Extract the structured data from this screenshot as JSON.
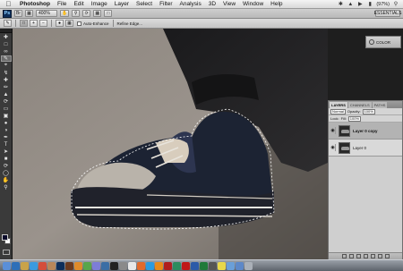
{
  "menubar": {
    "app_name": "Photoshop",
    "items": [
      "File",
      "Edit",
      "Image",
      "Layer",
      "Select",
      "Filter",
      "Analysis",
      "3D",
      "View",
      "Window",
      "Help"
    ],
    "battery_text": "(97%)",
    "icons": [
      "apple-icon",
      "bluetooth-icon",
      "wifi-icon",
      "volume-icon",
      "battery-icon",
      "search-icon"
    ]
  },
  "appbar": {
    "logo_text": "Ps",
    "zoom_value": "400%",
    "right_button": "ESSENTIALS"
  },
  "optbar": {
    "auto_enhance_label": "Auto-Enhance",
    "refine_edge_label": "Refine Edge..."
  },
  "collapsed_panel": {
    "label": "COLOR"
  },
  "layers_panel": {
    "tabs": [
      "LAYERS",
      "CHANNELS",
      "PATHS"
    ],
    "blend_mode": "Normal",
    "opacity_label": "Opacity:",
    "opacity_value": "100%",
    "fill_label": "Fill:",
    "fill_value": "100%",
    "lock_label": "Lock:",
    "layers": [
      {
        "name": "Layer 0 copy",
        "selected": true
      },
      {
        "name": "Layer 0",
        "selected": false
      }
    ]
  },
  "colors": {
    "foreground": "#0a0a2a",
    "background": "#ffffff"
  },
  "dock": {
    "items": [
      "finder",
      "dashboard",
      "mail",
      "safari",
      "ical",
      "addressbook",
      "photoshop",
      "bridge",
      "illustrator",
      "itunes",
      "iphoto",
      "preview",
      "terminal",
      "systemprefs",
      "textedit",
      "firefox",
      "skype",
      "vlc",
      "flash",
      "dreamweaver",
      "acrobat",
      "word",
      "excel",
      "calculator",
      "stickies",
      "folder",
      "downloads",
      "trash"
    ]
  }
}
